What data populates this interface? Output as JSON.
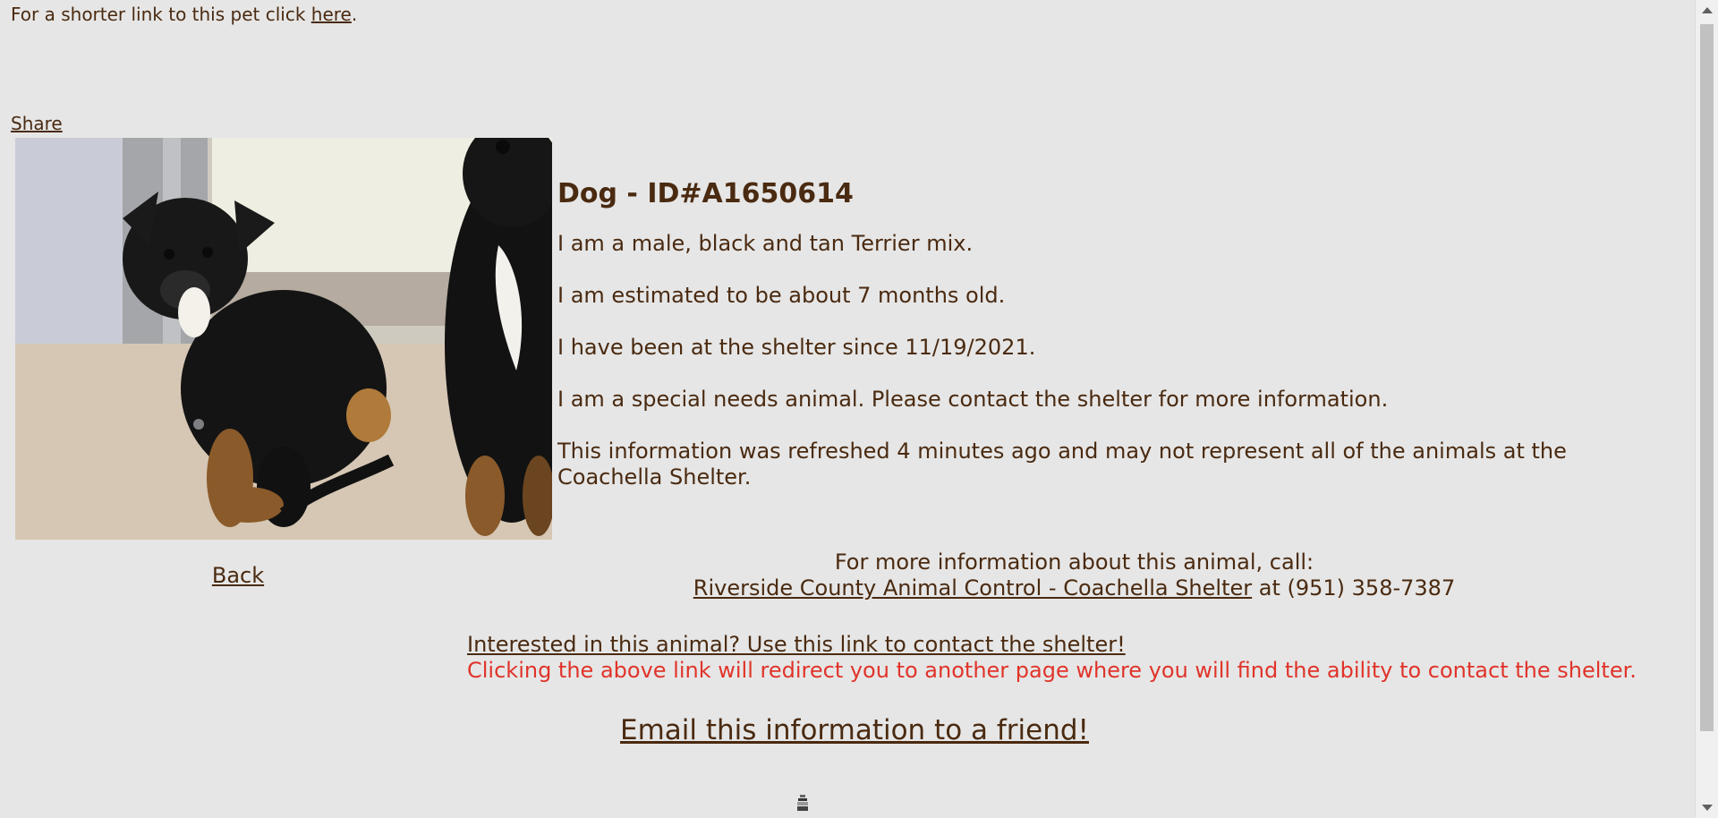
{
  "shortlink": {
    "prefix": "For a shorter link to this pet click ",
    "link": "here",
    "suffix": "."
  },
  "share_label": "Share",
  "back_label": "Back",
  "animal": {
    "title": "Dog - ID#A1650614",
    "description": "I am a male, black and tan Terrier mix.",
    "age": "I am estimated to be about 7 months old.",
    "since": "I have been at the shelter since 11/19/2021.",
    "special": "I am a special needs animal. Please contact the shelter for more information.",
    "refreshed": "This information was refreshed 4 minutes ago and may not represent all of the animals at the Coachella Shelter."
  },
  "contact": {
    "intro": "For more information about this animal, call:",
    "shelter_link": "Riverside County Animal Control - Coachella Shelter",
    "phone_text": " at (951) 358-7387"
  },
  "interest": {
    "link": "Interested in this animal? Use this link to contact the shelter!",
    "note": "Clicking the above link will redirect you to another page where you will find the ability to contact the shelter."
  },
  "email_label": "Email this information to a friend!"
}
